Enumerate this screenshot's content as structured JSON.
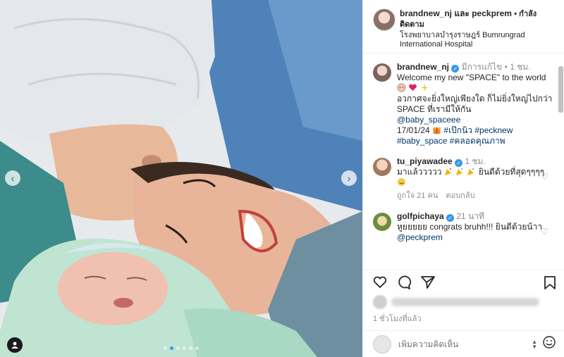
{
  "header": {
    "username": "brandnew_nj และ peckprem",
    "follow_label": "• กำลังติดตาม",
    "location": "โรงพยาบาลบำรุงราษฎร์ Bumrungrad International Hospital"
  },
  "caption": {
    "username": "brandnew_nj",
    "edited": "มีการแก้ไข",
    "time": "1 ชม.",
    "line1": "Welcome my new \"SPACE\" to the world",
    "line2": "อวกาศจะยิ่งใหญ่เพียงใด ก็ไม่ยิ่งใหญ่ไปกว่า SPACE ที่เรามีให้กัน",
    "mention": "@baby_spaceee",
    "date": "17/01/24",
    "hashtag1": "#เป๊กนิว",
    "hashtag2": "#pecknew",
    "hashtag3": "#baby_space",
    "hashtag4": "#คลอดคุณภาพ"
  },
  "comments": [
    {
      "username": "tu_piyawadee",
      "time": "1 ชม.",
      "text_a": "มาแล้ววววว",
      "text_b": "ยินดีด้วยที่สุดๆๆๆๆ",
      "likes": "ถูกใจ 21 คน",
      "reply": "ตอบกลับ"
    },
    {
      "username": "golfpichaya",
      "time": "21 นาที",
      "text_a": "หูยยยยย congrats bruhh!!! ยินดีด้วยน้าา",
      "mention": "@peckprem"
    }
  ],
  "post_time": "1 ชั่วโมงที่แล้ว",
  "add_comment": {
    "placeholder": "เพิ่มความคิดเห็น"
  },
  "icons": [
    "heart-icon",
    "comment-icon",
    "share-icon",
    "save-icon",
    "emoji-icon",
    "user-tag-icon"
  ],
  "colors": {
    "verified": "#3897f0",
    "link": "#00376b",
    "muted": "#8e8e8e"
  }
}
